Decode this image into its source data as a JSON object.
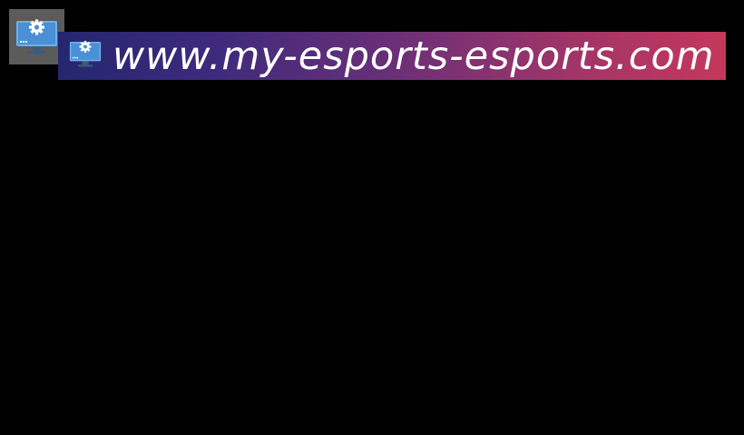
{
  "desktop": {
    "background_color": "#000000",
    "shortcut": {
      "icon": "monitor-settings-icon",
      "tile_color": "#5b5b5b"
    }
  },
  "banner": {
    "icon": "monitor-settings-icon",
    "text": "www.my-esports-esports.com",
    "gradient_colors": [
      "#24276f",
      "#6a2f78",
      "#c6375c"
    ],
    "text_color": "#ffffff"
  }
}
